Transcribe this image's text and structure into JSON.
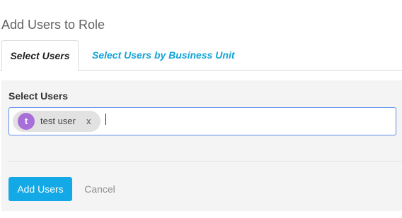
{
  "page": {
    "title": "Add Users to Role"
  },
  "tabs": [
    {
      "label": "Select Users",
      "active": true
    },
    {
      "label": "Select Users by Business Unit",
      "active": false
    }
  ],
  "form": {
    "field_label": "Select Users",
    "selected_users": [
      {
        "initial": "t",
        "name": "test user",
        "remove_label": "x",
        "avatar_color": "#a86fd9"
      }
    ],
    "input_value": ""
  },
  "actions": {
    "add_label": "Add Users",
    "cancel_label": "Cancel"
  },
  "colors": {
    "accent": "#12a9e6",
    "tab_link": "#12a4d8",
    "input_focus_border": "#5b8def",
    "panel_background": "#f4f4f4"
  }
}
